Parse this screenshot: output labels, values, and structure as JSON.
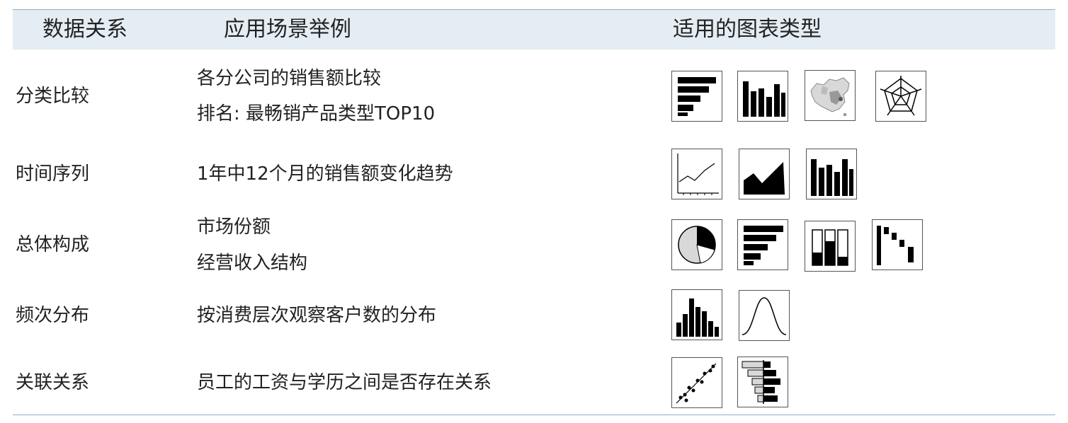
{
  "table": {
    "headers": [
      "数据关系",
      "应用场景举例",
      "适用的图表类型"
    ],
    "rows": [
      {
        "relation": "分类比较",
        "examples": [
          "各分公司的销售额比较",
          "排名: 最畅销产品类型TOP10"
        ],
        "chart_icons": [
          "horizontal-bar-chart-icon",
          "column-chart-icon",
          "china-map-icon",
          "radar-chart-icon"
        ]
      },
      {
        "relation": "时间序列",
        "examples": [
          "1年中12个月的销售额变化趋势"
        ],
        "chart_icons": [
          "line-chart-icon",
          "area-chart-icon",
          "column-chart-icon"
        ]
      },
      {
        "relation": "总体构成",
        "examples": [
          "市场份额",
          "经营收入结构"
        ],
        "chart_icons": [
          "pie-chart-icon",
          "horizontal-bar-chart-icon",
          "stacked-column-chart-icon",
          "waterfall-chart-icon"
        ]
      },
      {
        "relation": "频次分布",
        "examples": [
          "按消费层次观察客户数的分布"
        ],
        "chart_icons": [
          "histogram-icon",
          "normal-distribution-curve-icon"
        ]
      },
      {
        "relation": "关联关系",
        "examples": [
          "员工的工资与学历之间是否存在关系"
        ],
        "chart_icons": [
          "scatter-plot-icon",
          "population-pyramid-icon"
        ]
      }
    ]
  },
  "colors": {
    "header_bg": "#e4edf4",
    "rule": "#8fb0c4",
    "ink": "#000000",
    "light_fill": "#d8d8d8"
  }
}
